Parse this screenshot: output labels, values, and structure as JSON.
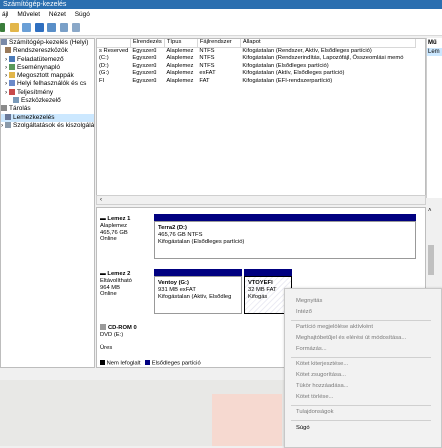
{
  "window": {
    "title": "Számítógép-kezelés"
  },
  "menu": [
    "ájl",
    "Művelet",
    "Nézet",
    "Súgó"
  ],
  "tree": [
    "Számítógép-kezelés (Helyi)",
    "Rendszereszközök",
    "Feladatütemező",
    "Eseménynapló",
    "Megosztott mappák",
    "Helyi felhasználók és cs",
    "Teljesítmény",
    "Eszközkezelő",
    "Tárolás",
    "Lemezkezelés",
    "Szolgáltatások és kiszolgálá"
  ],
  "volumes": {
    "headers": [
      "",
      "Elrendezés",
      "Típus",
      "Fájlrendszer",
      "Állapot"
    ],
    "rows": [
      [
        "s Reserved",
        "Egyszerű",
        "Alaplemez",
        "NTFS",
        "Kifogástalan (Rendszer, Aktív, Elsődleges partíció)"
      ],
      [
        "(C:)",
        "Egyszerű",
        "Alaplemez",
        "NTFS",
        "Kifogástalan (Rendszerindítás, Lapozófájl, Összeomlási memó"
      ],
      [
        "(D:)",
        "Egyszerű",
        "Alaplemez",
        "NTFS",
        "Kifogástalan (Elsődleges partíció)"
      ],
      [
        "(G:)",
        "Egyszerű",
        "Alaplemez",
        "exFAT",
        "Kifogástalan (Aktív, Elsődleges partíció)"
      ],
      [
        "FI",
        "Egyszerű",
        "Alaplemez",
        "FAT",
        "Kifogástalan (EFI-rendszerpartíció)"
      ]
    ]
  },
  "right_panel": {
    "header": "Mű",
    "item": "Lem"
  },
  "disks": {
    "disk1": {
      "name": "Lemez 1",
      "type": "Alaplemez",
      "size": "465,76 GB",
      "status": "Online",
      "part_name": "Terra2 (D:)",
      "part_size": "465,76 GB NTFS",
      "part_status": "Kifogástalan (Elsődleges partíció)"
    },
    "disk2": {
      "name": "Lemez 2",
      "type": "Eltávolítható",
      "size": "964 MB",
      "status": "Online",
      "part1_name": "Ventoy (G:)",
      "part1_size": "931 MB exFAT",
      "part1_status": "Kifogástalan (Aktív, Elsődleg",
      "part2_name": "VTOYEFI",
      "part2_size": "32 MB FAT",
      "part2_status": "Kifogás"
    },
    "cdrom": {
      "name": "CD-ROM 0",
      "drive": "DVD (E:)",
      "status": "Üres"
    }
  },
  "legend": {
    "unallocated": "Nem lefoglalt",
    "primary": "Elsődleges partíció"
  },
  "context_menu": {
    "open": "Megnyitás",
    "explore": "Intéző",
    "mark_active": "Partíció megjelölése aktívként",
    "change_letter": "Meghajtóbetűjel és elérési út módosítása...",
    "format": "Formázás...",
    "extend": "Kötet kiterjesztése...",
    "shrink": "Kötet zsugorítása...",
    "mirror": "Tükör hozzáadása...",
    "delete": "Kötet törlése...",
    "properties": "Tulajdonságok",
    "help": "Súgó"
  },
  "colors": {
    "titlebar": "#2b6fb0",
    "primary_partition": "#000080",
    "selection": "#cce8ff"
  }
}
